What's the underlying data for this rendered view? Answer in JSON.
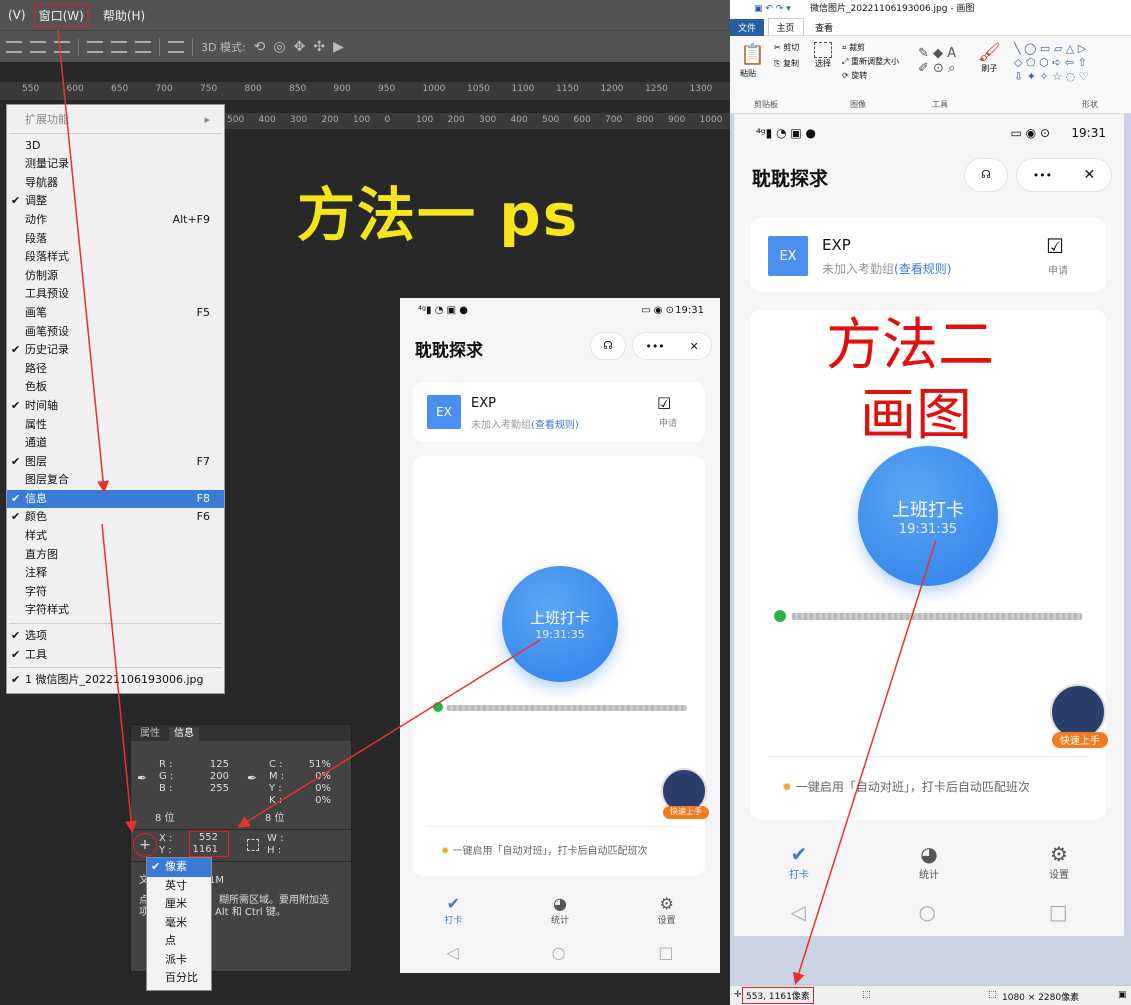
{
  "ps": {
    "menubar": {
      "prefix": "(V)",
      "window": "窗口(W)",
      "help": "帮助(H)"
    },
    "options": {
      "mode3d": "3D 模式:"
    },
    "ruler_top": [
      "550",
      "600",
      "650",
      "700",
      "750",
      "800",
      "850",
      "900",
      "950",
      "1000",
      "1050",
      "1100",
      "1150",
      "1200",
      "1250",
      "1300"
    ],
    "ruler_second": [
      "500",
      "400",
      "300",
      "200",
      "100",
      "0",
      "100",
      "200",
      "300",
      "400",
      "500",
      "600",
      "700",
      "800",
      "900",
      "1000"
    ],
    "menu": {
      "header": "扩展功能",
      "items": [
        {
          "label": "3D",
          "check": "",
          "shortcut": ""
        },
        {
          "label": "测量记录",
          "check": "",
          "shortcut": ""
        },
        {
          "label": "导航器",
          "check": "",
          "shortcut": ""
        },
        {
          "label": "调整",
          "check": "✔",
          "shortcut": ""
        },
        {
          "label": "动作",
          "check": "",
          "shortcut": "Alt+F9"
        },
        {
          "label": "段落",
          "check": "",
          "shortcut": ""
        },
        {
          "label": "段落样式",
          "check": "",
          "shortcut": ""
        },
        {
          "label": "仿制源",
          "check": "",
          "shortcut": ""
        },
        {
          "label": "工具预设",
          "check": "",
          "shortcut": ""
        },
        {
          "label": "画笔",
          "check": "",
          "shortcut": "F5"
        },
        {
          "label": "画笔预设",
          "check": "",
          "shortcut": ""
        },
        {
          "label": "历史记录",
          "check": "✔",
          "shortcut": ""
        },
        {
          "label": "路径",
          "check": "",
          "shortcut": ""
        },
        {
          "label": "色板",
          "check": "",
          "shortcut": ""
        },
        {
          "label": "时间轴",
          "check": "✔",
          "shortcut": ""
        },
        {
          "label": "属性",
          "check": "",
          "shortcut": ""
        },
        {
          "label": "通道",
          "check": "",
          "shortcut": ""
        },
        {
          "label": "图层",
          "check": "✔",
          "shortcut": "F7"
        },
        {
          "label": "图层复合",
          "check": "",
          "shortcut": ""
        },
        {
          "label": "信息",
          "check": "✔",
          "shortcut": "F8",
          "selected": true
        },
        {
          "label": "颜色",
          "check": "✔",
          "shortcut": "F6"
        },
        {
          "label": "样式",
          "check": "",
          "shortcut": ""
        },
        {
          "label": "直方图",
          "check": "",
          "shortcut": ""
        },
        {
          "label": "注释",
          "check": "",
          "shortcut": ""
        },
        {
          "label": "字符",
          "check": "",
          "shortcut": ""
        },
        {
          "label": "字符样式",
          "check": "",
          "shortcut": ""
        }
      ],
      "items2": [
        {
          "label": "选项",
          "check": "✔"
        },
        {
          "label": "工具",
          "check": "✔"
        }
      ],
      "doc": "1 微信图片_20221106193006.jpg",
      "doc_check": "✔"
    },
    "annotation": "方法一 ps",
    "info_panel": {
      "tab_props": "属性",
      "tab_info": "信息",
      "r_label": "R :",
      "r": "125",
      "g_label": "G :",
      "g": "200",
      "b_label": "B :",
      "b": "255",
      "c_label": "C :",
      "c": "51%",
      "m_label": "M :",
      "m": "0%",
      "y_label": "Y :",
      "y": "0%",
      "k_label": "K :",
      "k": "0%",
      "bits_left": "8 位",
      "bits_right": "8 位",
      "x_label": "X :",
      "x": "552",
      "y2_label": "Y :",
      "y2": "1161",
      "w_label": "W :",
      "h_label": "H :",
      "doc_prefix": "文",
      "doc_suffix": "1M",
      "hint1": "点",
      "hint1b": "糊所需区域。要用附加选",
      "hint2": "项",
      "hint2b": "Alt 和 Ctrl 键。"
    },
    "unit_dropdown": [
      "像素",
      "英寸",
      "厘米",
      "毫米",
      "点",
      "派卡",
      "百分比"
    ],
    "unit_selected_check": "✔"
  },
  "phone": {
    "status_time": "19:31",
    "title": "耽耽探求",
    "more": "•••",
    "close": "✕",
    "org_abbr": "EX",
    "org_name": "EXP",
    "org_sub": "未加入考勤组",
    "rule_link": "(查看规则)",
    "apply": "申请",
    "punch_label": "上班打卡",
    "punch_time": "19:31:35",
    "mascot_tag": "快速上手",
    "hint": "一键启用「自动对班」，打卡后自动匹配班次",
    "nav": [
      "打卡",
      "统计",
      "设置"
    ]
  },
  "paint": {
    "title": "微信图片_20221106193006.jpg - 画图",
    "tabs": [
      "文件",
      "主页",
      "查看"
    ],
    "groups": [
      "剪贴板",
      "图像",
      "工具",
      "形状"
    ],
    "clip": {
      "paste": "粘贴",
      "cut": "剪切",
      "copy": "复制"
    },
    "image": {
      "select": "选择",
      "crop": "裁剪",
      "resize": "重新调整大小",
      "rotate": "旋转"
    },
    "brush": "刷子",
    "annotation_l1": "方法二",
    "annotation_l2": "画图",
    "status_coords": "553, 1161像素",
    "status_size": "1080 × 2280像素"
  },
  "colors": {
    "accent": "#3a7bd5",
    "annotation_yellow": "#f5e51a",
    "annotation_red": "#e01010",
    "arrow": "#e8322e",
    "punch": "#3f8ff0"
  }
}
